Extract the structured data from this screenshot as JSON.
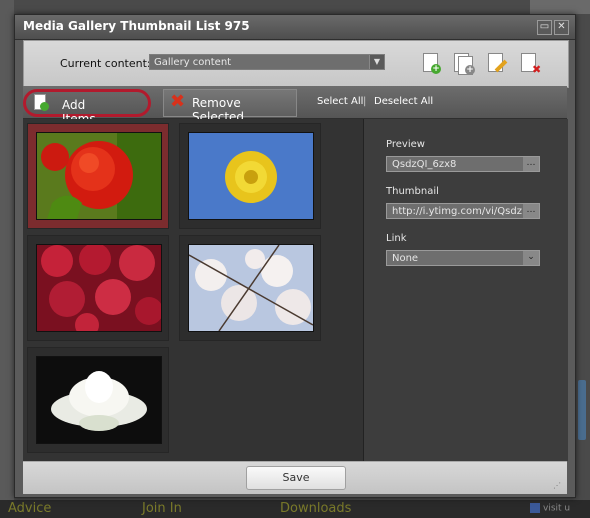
{
  "window": {
    "title": "Media Gallery Thumbnail List 975",
    "controls": {
      "minimize_icon": "minimize-icon",
      "close_icon": "close-icon",
      "minimize_glyph": "▭",
      "close_glyph": "✕"
    }
  },
  "content_bar": {
    "label": "Current content:",
    "select_value": "Gallery content",
    "tool_icons": [
      "add-document-icon",
      "duplicate-document-icon",
      "edit-document-icon",
      "delete-document-icon"
    ]
  },
  "action_bar": {
    "add_items": "Add Items",
    "remove_selected": "Remove Selected",
    "select_all": "Select All",
    "separator": "|",
    "deselect_all": "Deselect All",
    "highlight_color": "#b21a2d"
  },
  "gallery": {
    "thumbnails": [
      {
        "name": "red-rose",
        "selected": true
      },
      {
        "name": "yellow-dandelion",
        "selected": false
      },
      {
        "name": "red-roses-bunch",
        "selected": false
      },
      {
        "name": "cherry-blossom",
        "selected": false
      },
      {
        "name": "white-lotus",
        "selected": false
      }
    ]
  },
  "details": {
    "preview_label": "Preview",
    "preview_value": "QsdzQI_6zx8",
    "thumbnail_label": "Thumbnail",
    "thumbnail_value": "http://i.ytimg.com/vi/Qsdz",
    "link_label": "Link",
    "link_value": "None",
    "browse_glyph": "…",
    "dropdown_glyph": "⌄"
  },
  "footer": {
    "save_label": "Save"
  },
  "background_page": {
    "nav_items": [
      "Advice",
      "Join In",
      "Downloads"
    ],
    "fb_text": "visit u"
  }
}
